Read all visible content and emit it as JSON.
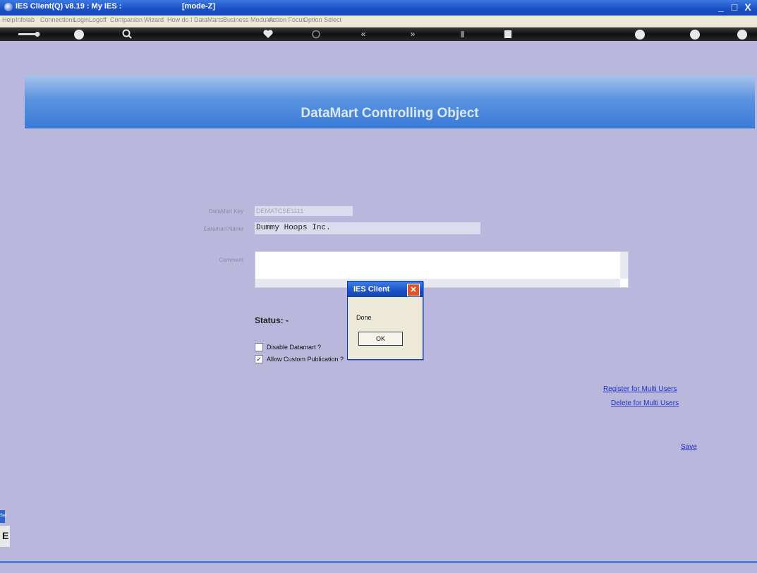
{
  "window": {
    "title": "IES Client(Q) v8.19 : My IES :",
    "mode": "[mode-Z]",
    "minimize": "_",
    "maximize": "□",
    "close": "X"
  },
  "menu": [
    "Help",
    "Infolab",
    "Connections",
    "Login",
    "Logoff",
    "Companion",
    "Wizard",
    "How do I",
    "DataMarts",
    "Business Modules",
    "Action Focus",
    "Option Select"
  ],
  "toolbar": {
    "icons": [
      "key-icon",
      "help-icon",
      "search-icon",
      "heart-icon",
      "refresh-icon",
      "prev-icon",
      "next-icon",
      "new-icon",
      "stop-icon",
      "print-icon",
      "check-icon",
      "close-icon"
    ],
    "glyphs": {
      "prev": "«",
      "next": "»"
    }
  },
  "header": {
    "title": "DataMart Controlling Object"
  },
  "form": {
    "datamart_key_label": "DataMart Key",
    "datamart_key_value": "DEMATCSE1111",
    "datamart_name_label": "Datamart Name",
    "datamart_name_value": "Dummy Hoops Inc.",
    "comment_label": "Comment",
    "status_label": "Status: -",
    "disable_label": "Disable Datamart ?",
    "allow_label": "Allow Custom Publication ?"
  },
  "links": {
    "register": "Register for Multi Users",
    "delete": "Delete for Multi Users",
    "save": "Save"
  },
  "dialog": {
    "title": "IES Client",
    "message": "Done",
    "ok": "OK"
  },
  "sidebar": {
    "tag": "Ser",
    "letter": "E"
  }
}
